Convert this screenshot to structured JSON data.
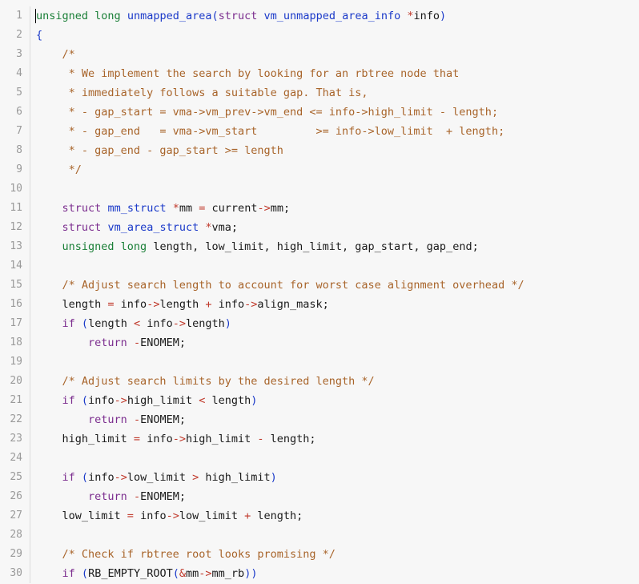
{
  "editor": {
    "language": "c",
    "background_color": "#f7f7f7",
    "gutter_color": "#9a9a9a",
    "line_height": 24,
    "first_line": 1,
    "last_line": 30,
    "cursor_line": 1,
    "cursor_column": 1,
    "colors": {
      "type_keyword": "#1a7f37",
      "control_keyword": "#7b2d8e",
      "function_name": "#1a39c9",
      "operator": "#c0392b",
      "identifier": "#1a1a1a",
      "comment": "#a8642a",
      "line_number": "#9a9a9a"
    },
    "line_numbers": [
      1,
      2,
      3,
      4,
      5,
      6,
      7,
      8,
      9,
      10,
      11,
      12,
      13,
      14,
      15,
      16,
      17,
      18,
      19,
      20,
      21,
      22,
      23,
      24,
      25,
      26,
      27,
      28,
      29,
      30
    ],
    "lines": [
      {
        "number": 1,
        "text": "unsigned long unmapped_area(struct vm_unmapped_area_info *info)",
        "tokens": [
          {
            "t": "unsigned long",
            "c": "t-type"
          },
          {
            "t": " ",
            "c": "t-id"
          },
          {
            "t": "unmapped_area",
            "c": "t-fn"
          },
          {
            "t": "(",
            "c": "t-punct"
          },
          {
            "t": "struct",
            "c": "t-kw"
          },
          {
            "t": " ",
            "c": "t-id"
          },
          {
            "t": "vm_unmapped_area_info",
            "c": "t-fn"
          },
          {
            "t": " ",
            "c": "t-id"
          },
          {
            "t": "*",
            "c": "t-op"
          },
          {
            "t": "info",
            "c": "t-id"
          },
          {
            "t": ")",
            "c": "t-punct"
          }
        ]
      },
      {
        "number": 2,
        "text": "{",
        "tokens": [
          {
            "t": "{",
            "c": "t-punct"
          }
        ]
      },
      {
        "number": 3,
        "text": "    /*",
        "tokens": [
          {
            "t": "    /*",
            "c": "t-comment"
          }
        ]
      },
      {
        "number": 4,
        "text": "     * We implement the search by looking for an rbtree node that",
        "tokens": [
          {
            "t": "     * We implement the search by looking for an rbtree node that",
            "c": "t-comment"
          }
        ]
      },
      {
        "number": 5,
        "text": "     * immediately follows a suitable gap. That is,",
        "tokens": [
          {
            "t": "     * immediately follows a suitable gap. That is,",
            "c": "t-comment"
          }
        ]
      },
      {
        "number": 6,
        "text": "     * - gap_start = vma->vm_prev->vm_end <= info->high_limit - length;",
        "tokens": [
          {
            "t": "     * - gap_start = vma->vm_prev->vm_end <= info->high_limit - length;",
            "c": "t-comment"
          }
        ]
      },
      {
        "number": 7,
        "text": "     * - gap_end   = vma->vm_start         >= info->low_limit  + length;",
        "tokens": [
          {
            "t": "     * - gap_end   = vma->vm_start         >= info->low_limit  + length;",
            "c": "t-comment"
          }
        ]
      },
      {
        "number": 8,
        "text": "     * - gap_end - gap_start >= length",
        "tokens": [
          {
            "t": "     * - gap_end - gap_start >= length",
            "c": "t-comment"
          }
        ]
      },
      {
        "number": 9,
        "text": "     */",
        "tokens": [
          {
            "t": "     */",
            "c": "t-comment"
          }
        ]
      },
      {
        "number": 10,
        "text": "",
        "tokens": []
      },
      {
        "number": 11,
        "text": "    struct mm_struct *mm = current->mm;",
        "tokens": [
          {
            "t": "    ",
            "c": "t-id"
          },
          {
            "t": "struct",
            "c": "t-kw"
          },
          {
            "t": " ",
            "c": "t-id"
          },
          {
            "t": "mm_struct",
            "c": "t-fn"
          },
          {
            "t": " ",
            "c": "t-id"
          },
          {
            "t": "*",
            "c": "t-op"
          },
          {
            "t": "mm",
            "c": "t-id"
          },
          {
            "t": " ",
            "c": "t-id"
          },
          {
            "t": "=",
            "c": "t-op"
          },
          {
            "t": " current",
            "c": "t-id"
          },
          {
            "t": "->",
            "c": "t-op"
          },
          {
            "t": "mm;",
            "c": "t-id"
          }
        ]
      },
      {
        "number": 12,
        "text": "    struct vm_area_struct *vma;",
        "tokens": [
          {
            "t": "    ",
            "c": "t-id"
          },
          {
            "t": "struct",
            "c": "t-kw"
          },
          {
            "t": " ",
            "c": "t-id"
          },
          {
            "t": "vm_area_struct",
            "c": "t-fn"
          },
          {
            "t": " ",
            "c": "t-id"
          },
          {
            "t": "*",
            "c": "t-op"
          },
          {
            "t": "vma;",
            "c": "t-id"
          }
        ]
      },
      {
        "number": 13,
        "text": "    unsigned long length, low_limit, high_limit, gap_start, gap_end;",
        "tokens": [
          {
            "t": "    ",
            "c": "t-id"
          },
          {
            "t": "unsigned long",
            "c": "t-type"
          },
          {
            "t": " length, low_limit, high_limit, gap_start, gap_end;",
            "c": "t-id"
          }
        ]
      },
      {
        "number": 14,
        "text": "",
        "tokens": []
      },
      {
        "number": 15,
        "text": "    /* Adjust search length to account for worst case alignment overhead */",
        "tokens": [
          {
            "t": "    /* Adjust search length to account for worst case alignment overhead */",
            "c": "t-comment"
          }
        ]
      },
      {
        "number": 16,
        "text": "    length = info->length + info->align_mask;",
        "tokens": [
          {
            "t": "    length ",
            "c": "t-id"
          },
          {
            "t": "=",
            "c": "t-op"
          },
          {
            "t": " info",
            "c": "t-id"
          },
          {
            "t": "->",
            "c": "t-op"
          },
          {
            "t": "length ",
            "c": "t-id"
          },
          {
            "t": "+",
            "c": "t-op"
          },
          {
            "t": " info",
            "c": "t-id"
          },
          {
            "t": "->",
            "c": "t-op"
          },
          {
            "t": "align_mask;",
            "c": "t-id"
          }
        ]
      },
      {
        "number": 17,
        "text": "    if (length < info->length)",
        "tokens": [
          {
            "t": "    ",
            "c": "t-id"
          },
          {
            "t": "if",
            "c": "t-kw"
          },
          {
            "t": " ",
            "c": "t-id"
          },
          {
            "t": "(",
            "c": "t-punct"
          },
          {
            "t": "length ",
            "c": "t-id"
          },
          {
            "t": "<",
            "c": "t-op"
          },
          {
            "t": " info",
            "c": "t-id"
          },
          {
            "t": "->",
            "c": "t-op"
          },
          {
            "t": "length",
            "c": "t-id"
          },
          {
            "t": ")",
            "c": "t-punct"
          }
        ]
      },
      {
        "number": 18,
        "text": "        return -ENOMEM;",
        "tokens": [
          {
            "t": "        ",
            "c": "t-id"
          },
          {
            "t": "return",
            "c": "t-kw"
          },
          {
            "t": " ",
            "c": "t-id"
          },
          {
            "t": "-",
            "c": "t-op"
          },
          {
            "t": "ENOMEM;",
            "c": "t-id"
          }
        ]
      },
      {
        "number": 19,
        "text": "",
        "tokens": []
      },
      {
        "number": 20,
        "text": "    /* Adjust search limits by the desired length */",
        "tokens": [
          {
            "t": "    /* Adjust search limits by the desired length */",
            "c": "t-comment"
          }
        ]
      },
      {
        "number": 21,
        "text": "    if (info->high_limit < length)",
        "tokens": [
          {
            "t": "    ",
            "c": "t-id"
          },
          {
            "t": "if",
            "c": "t-kw"
          },
          {
            "t": " ",
            "c": "t-id"
          },
          {
            "t": "(",
            "c": "t-punct"
          },
          {
            "t": "info",
            "c": "t-id"
          },
          {
            "t": "->",
            "c": "t-op"
          },
          {
            "t": "high_limit ",
            "c": "t-id"
          },
          {
            "t": "<",
            "c": "t-op"
          },
          {
            "t": " length",
            "c": "t-id"
          },
          {
            "t": ")",
            "c": "t-punct"
          }
        ]
      },
      {
        "number": 22,
        "text": "        return -ENOMEM;",
        "tokens": [
          {
            "t": "        ",
            "c": "t-id"
          },
          {
            "t": "return",
            "c": "t-kw"
          },
          {
            "t": " ",
            "c": "t-id"
          },
          {
            "t": "-",
            "c": "t-op"
          },
          {
            "t": "ENOMEM;",
            "c": "t-id"
          }
        ]
      },
      {
        "number": 23,
        "text": "    high_limit = info->high_limit - length;",
        "tokens": [
          {
            "t": "    high_limit ",
            "c": "t-id"
          },
          {
            "t": "=",
            "c": "t-op"
          },
          {
            "t": " info",
            "c": "t-id"
          },
          {
            "t": "->",
            "c": "t-op"
          },
          {
            "t": "high_limit ",
            "c": "t-id"
          },
          {
            "t": "-",
            "c": "t-op"
          },
          {
            "t": " length;",
            "c": "t-id"
          }
        ]
      },
      {
        "number": 24,
        "text": "",
        "tokens": []
      },
      {
        "number": 25,
        "text": "    if (info->low_limit > high_limit)",
        "tokens": [
          {
            "t": "    ",
            "c": "t-id"
          },
          {
            "t": "if",
            "c": "t-kw"
          },
          {
            "t": " ",
            "c": "t-id"
          },
          {
            "t": "(",
            "c": "t-punct"
          },
          {
            "t": "info",
            "c": "t-id"
          },
          {
            "t": "->",
            "c": "t-op"
          },
          {
            "t": "low_limit ",
            "c": "t-id"
          },
          {
            "t": ">",
            "c": "t-op"
          },
          {
            "t": " high_limit",
            "c": "t-id"
          },
          {
            "t": ")",
            "c": "t-punct"
          }
        ]
      },
      {
        "number": 26,
        "text": "        return -ENOMEM;",
        "tokens": [
          {
            "t": "        ",
            "c": "t-id"
          },
          {
            "t": "return",
            "c": "t-kw"
          },
          {
            "t": " ",
            "c": "t-id"
          },
          {
            "t": "-",
            "c": "t-op"
          },
          {
            "t": "ENOMEM;",
            "c": "t-id"
          }
        ]
      },
      {
        "number": 27,
        "text": "    low_limit = info->low_limit + length;",
        "tokens": [
          {
            "t": "    low_limit ",
            "c": "t-id"
          },
          {
            "t": "=",
            "c": "t-op"
          },
          {
            "t": " info",
            "c": "t-id"
          },
          {
            "t": "->",
            "c": "t-op"
          },
          {
            "t": "low_limit ",
            "c": "t-id"
          },
          {
            "t": "+",
            "c": "t-op"
          },
          {
            "t": " length;",
            "c": "t-id"
          }
        ]
      },
      {
        "number": 28,
        "text": "",
        "tokens": []
      },
      {
        "number": 29,
        "text": "    /* Check if rbtree root looks promising */",
        "tokens": [
          {
            "t": "    /* Check if rbtree root looks promising */",
            "c": "t-comment"
          }
        ]
      },
      {
        "number": 30,
        "text": "    if (RB_EMPTY_ROOT(&mm->mm_rb))",
        "tokens": [
          {
            "t": "    ",
            "c": "t-id"
          },
          {
            "t": "if",
            "c": "t-kw"
          },
          {
            "t": " ",
            "c": "t-id"
          },
          {
            "t": "(",
            "c": "t-punct"
          },
          {
            "t": "RB_EMPTY_ROOT",
            "c": "t-id"
          },
          {
            "t": "(",
            "c": "t-punct"
          },
          {
            "t": "&",
            "c": "t-op"
          },
          {
            "t": "mm",
            "c": "t-id"
          },
          {
            "t": "->",
            "c": "t-op"
          },
          {
            "t": "mm_rb",
            "c": "t-id"
          },
          {
            "t": ")",
            "c": "t-punct"
          },
          {
            "t": ")",
            "c": "t-punct"
          }
        ]
      }
    ]
  }
}
